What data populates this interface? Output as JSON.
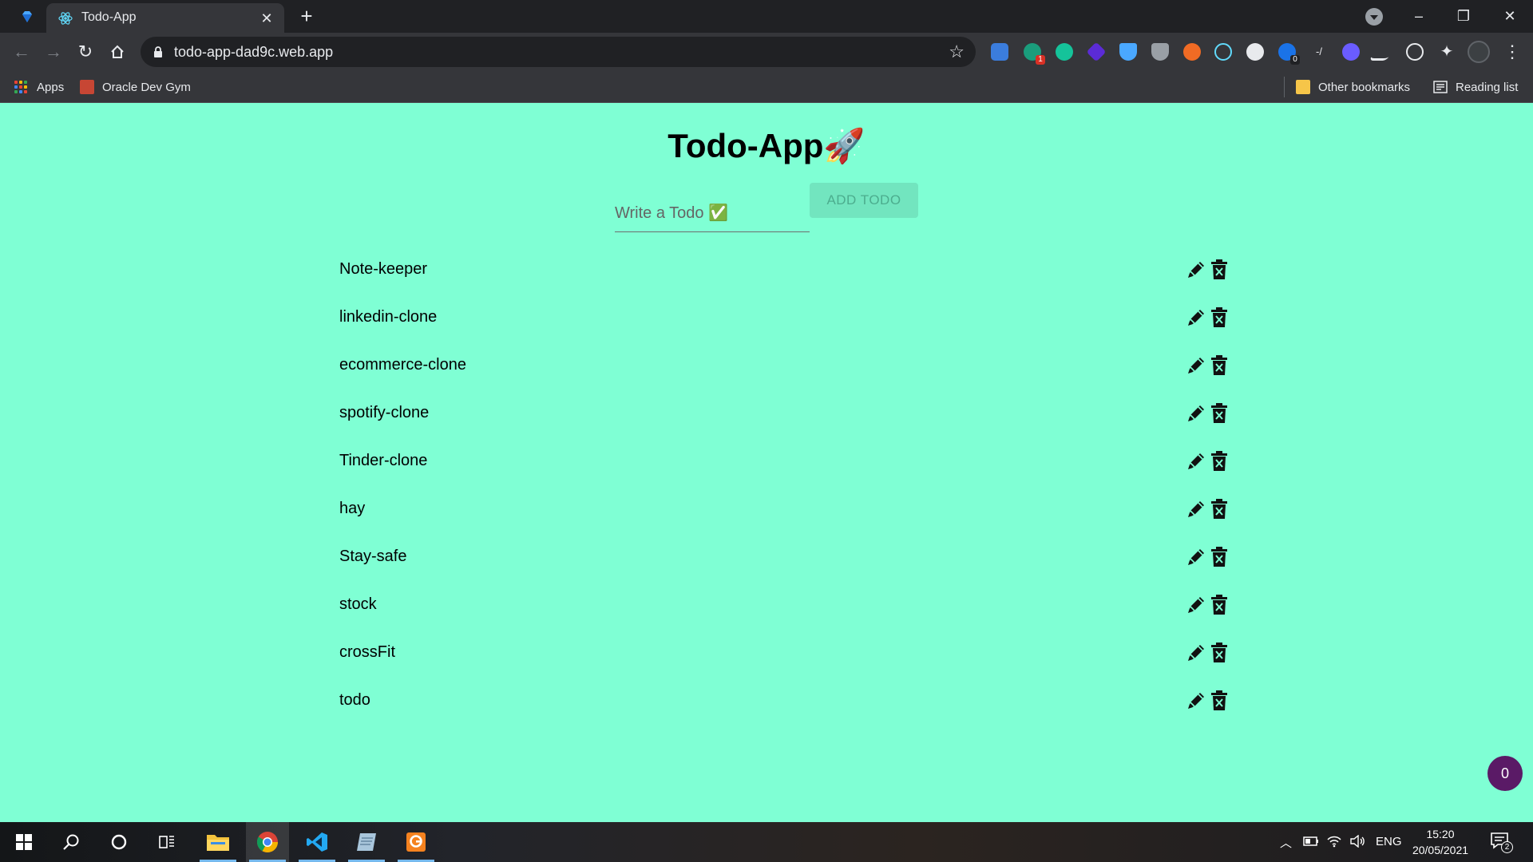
{
  "browser": {
    "tab_title": "Todo-App",
    "url": "todo-app-dad9c.web.app",
    "extension_badges": {
      "ext_2": "1",
      "ext_10": "0"
    }
  },
  "bookmarks": {
    "apps": "Apps",
    "oracle": "Oracle Dev Gym",
    "other": "Other bookmarks",
    "reading": "Reading list"
  },
  "app": {
    "title": "Todo-App🚀",
    "input_placeholder": "Write a Todo ✅",
    "add_button": "ADD TODO",
    "todos": [
      "Note-keeper",
      "linkedin-clone",
      "ecommerce-clone",
      "spotify-clone",
      "Tinder-clone",
      "hay",
      "Stay-safe",
      "stock",
      "crossFit",
      "todo"
    ],
    "fab_count": "0"
  },
  "taskbar": {
    "language": "ENG",
    "time": "15:20",
    "date": "20/05/2021",
    "notifications": "2"
  },
  "colors": {
    "page_background": "#7fffd4",
    "add_button_bg": "#72e5bf",
    "fab_bg": "#5a1a66"
  }
}
